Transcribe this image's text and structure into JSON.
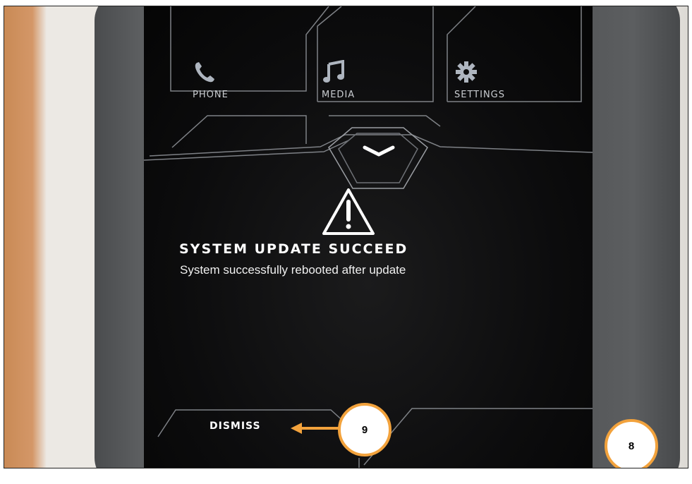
{
  "tiles": [
    {
      "label": "PHONE",
      "icon": "phone-icon"
    },
    {
      "label": "MEDIA",
      "icon": "music-note-icon"
    },
    {
      "label": "SETTINGS",
      "icon": "gear-icon"
    }
  ],
  "alert": {
    "icon": "warning-triangle-icon",
    "title": "SYSTEM UPDATE SUCCEED",
    "message": "System successfully rebooted after update"
  },
  "actions": {
    "dismiss_label": "DISMISS",
    "expand_icon": "chevron-down-icon"
  },
  "callouts": [
    {
      "label": "9"
    },
    {
      "label": "8"
    }
  ],
  "colors": {
    "callout_border": "#f2a23c",
    "screen_bg": "#0c0c0d",
    "line": "#8a8d92"
  }
}
